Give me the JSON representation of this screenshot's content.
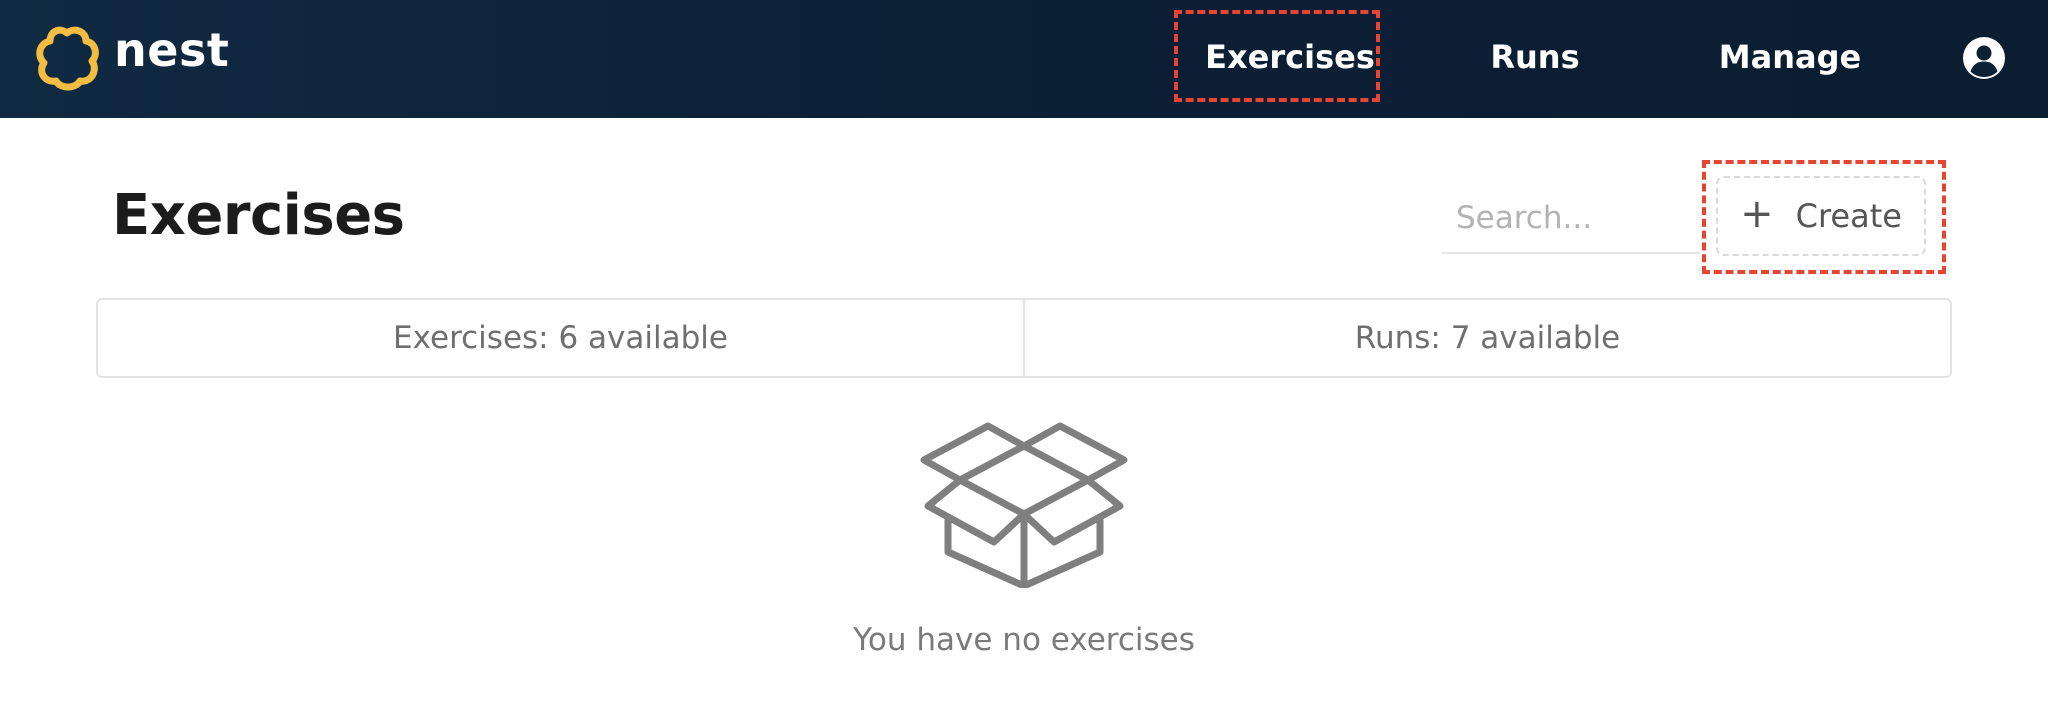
{
  "app": {
    "brand_name": "nest",
    "logo_icon": "nest-logo-icon",
    "brand_color": "#f3bd42"
  },
  "navbar": {
    "links": [
      {
        "label": "Exercises",
        "active": true
      },
      {
        "label": "Runs",
        "active": false
      },
      {
        "label": "Manage",
        "active": false
      }
    ],
    "user_icon": "user-circle-icon",
    "background_color": "#0c2036"
  },
  "page": {
    "title": "Exercises"
  },
  "search": {
    "placeholder": "Search...",
    "value": ""
  },
  "create_button": {
    "icon": "plus-icon",
    "label": "Create"
  },
  "stats": {
    "exercises": "Exercises: 6 available",
    "runs": "Runs: 7 available"
  },
  "empty_state": {
    "icon": "open-box-icon",
    "message": "You have no exercises"
  },
  "highlight_color": "#e8442f"
}
